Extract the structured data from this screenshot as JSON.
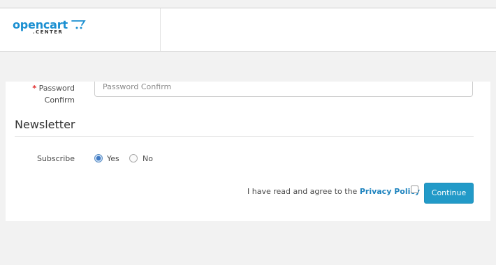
{
  "header": {
    "logo_text": "opencart",
    "logo_subtext": ".CENTER"
  },
  "form": {
    "password_confirm": {
      "required_marker": "*",
      "label_line1": "Password",
      "label_line2": "Confirm",
      "placeholder": "Password Confirm",
      "value": ""
    },
    "newsletter": {
      "legend": "Newsletter",
      "subscribe_label": "Subscribe",
      "options": [
        {
          "label": "Yes",
          "selected": true
        },
        {
          "label": "No",
          "selected": false
        }
      ]
    },
    "agree": {
      "text": "I have read and agree to the",
      "link": "Privacy Policy",
      "checked": false
    },
    "continue_label": "Continue"
  },
  "colors": {
    "brand": "#1a8fd1",
    "button": "#229ac8",
    "link": "#1f84bf",
    "required": "#e02a2a",
    "page_bg": "#f2f2f2"
  }
}
